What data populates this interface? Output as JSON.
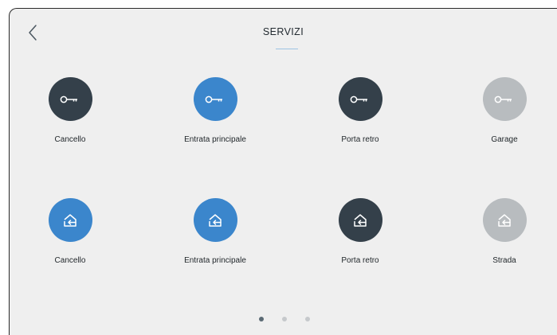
{
  "header": {
    "title": "SERVIZI",
    "back_icon": "chevron-left-icon"
  },
  "colors": {
    "dark": "#34404a",
    "blue": "#3b86cc",
    "gray": "#b8bcbf",
    "background": "#efefef",
    "accent_line": "#9cc3e3"
  },
  "rows": [
    {
      "icon": "key-icon",
      "items": [
        {
          "label": "Cancello",
          "color": "#34404a"
        },
        {
          "label": "Entrata principale",
          "color": "#3b86cc"
        },
        {
          "label": "Porta retro",
          "color": "#34404a"
        },
        {
          "label": "Garage",
          "color": "#b8bcbf"
        }
      ]
    },
    {
      "icon": "enter-house-icon",
      "items": [
        {
          "label": "Cancello",
          "color": "#3b86cc"
        },
        {
          "label": "Entrata principale",
          "color": "#3b86cc"
        },
        {
          "label": "Porta retro",
          "color": "#34404a"
        },
        {
          "label": "Strada",
          "color": "#b8bcbf"
        }
      ]
    }
  ],
  "pagination": {
    "pages": 3,
    "current": 1
  }
}
